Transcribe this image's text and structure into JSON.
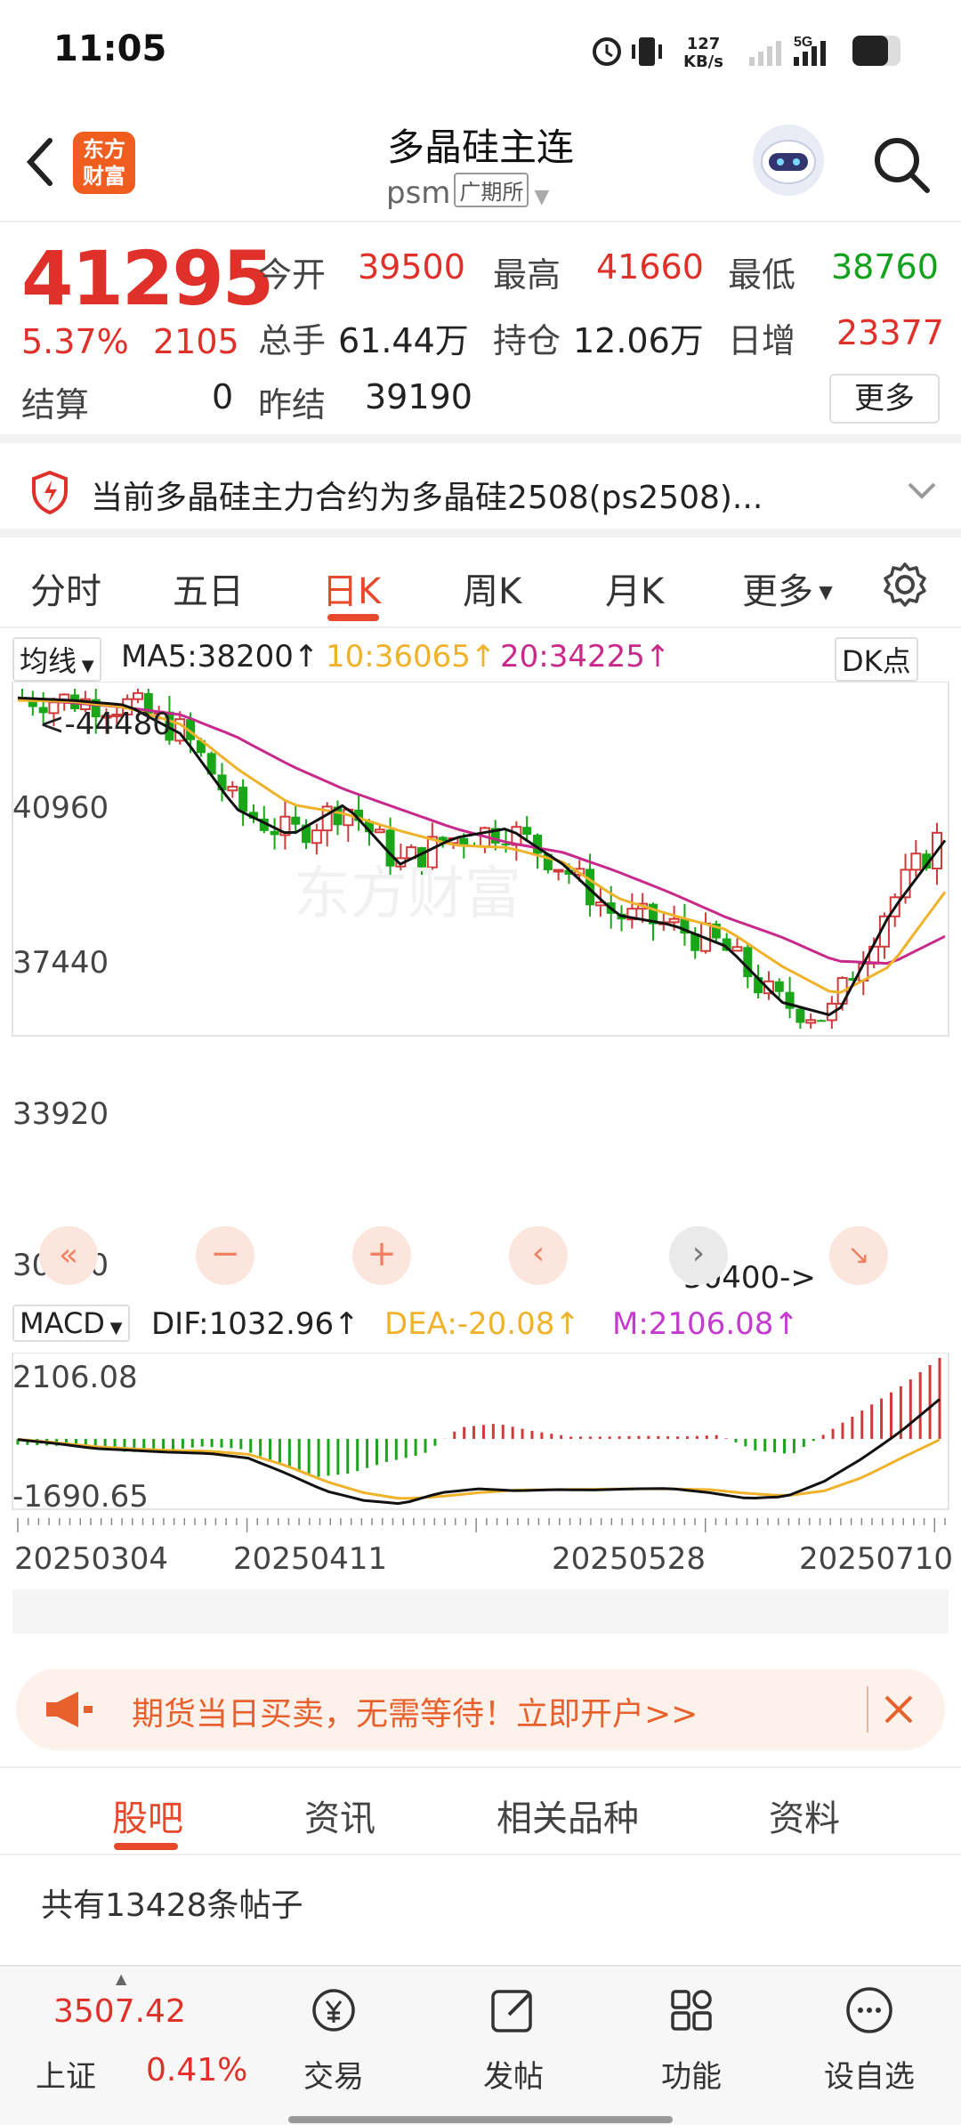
{
  "status": {
    "time": "11:05",
    "net_speed": "127",
    "net_unit": "KB/s",
    "signal_label": "5G"
  },
  "header": {
    "title": "多晶硅主连",
    "code": "psm",
    "exchange": "广期所",
    "logo_line1": "东方",
    "logo_line2": "财富"
  },
  "quote": {
    "price": "41295",
    "change_pct": "5.37%",
    "change": "2105",
    "open_label": "今开",
    "open": "39500",
    "high_label": "最高",
    "high": "41660",
    "low_label": "最低",
    "low": "38760",
    "volume_label": "总手",
    "volume": "61.44万",
    "oi_label": "持仓",
    "oi": "12.06万",
    "daily_add_label": "日增",
    "daily_add": "23377",
    "settle_label": "结算",
    "settle": "0",
    "prev_settle_label": "昨结",
    "prev_settle": "39190",
    "more_label": "更多"
  },
  "notice": {
    "text": "当前多晶硅主力合约为多晶硅2508(ps2508)..."
  },
  "ktabs": [
    "分时",
    "五日",
    "日K",
    "周K",
    "月K",
    "更多"
  ],
  "chart": {
    "ma_select": "均线",
    "ma5": "MA5:38200",
    "ma10": "10:36065",
    "ma20": "20:34225",
    "dk": "DK点",
    "y_labels": [
      "40960",
      "37440",
      "33920",
      "30400"
    ],
    "high_marker": "<-44480",
    "low_marker": "30400->",
    "macd_select": "MACD",
    "dif": "DIF:1032.96",
    "dea": "DEA:-20.08",
    "m": "M:2106.08",
    "macd_max": "2106.08",
    "macd_min": "-1690.65",
    "dates": [
      "20250304",
      "20250411",
      "20250528",
      "20250710"
    ],
    "colors": {
      "up": "#d13a3a",
      "down": "#19a619",
      "ma5": "#111111",
      "ma10": "#f0b22a",
      "ma20": "#c82a8c"
    }
  },
  "chart_data": {
    "type": "candlestick",
    "x": [
      "20250304",
      "20250411",
      "20250528",
      "20250710"
    ],
    "ylim": [
      30400,
      44480
    ],
    "ma5_close": [
      44100,
      44000,
      43800,
      42600,
      39500,
      38400,
      39700,
      37200,
      38300,
      38700,
      37200,
      35100,
      34700,
      33800,
      31500,
      30900,
      35200,
      38200
    ],
    "ma10_close": [
      44000,
      43950,
      43700,
      43000,
      41200,
      39700,
      39300,
      38600,
      38000,
      37900,
      37300,
      35800,
      35100,
      34500,
      33000,
      31800,
      33000,
      36065
    ],
    "ma20_close": [
      44050,
      43900,
      43700,
      43400,
      42500,
      41300,
      40300,
      39500,
      38700,
      38100,
      37700,
      36900,
      36000,
      35000,
      34200,
      33200,
      33100,
      34225
    ],
    "macd": {
      "range": [
        -1690.65,
        2106.08
      ],
      "dif_last": 1032.96,
      "dea_last": -20.08,
      "m_last": 2106.08
    }
  },
  "banner": {
    "text": "期货当日买卖，无需等待！立即开户>>"
  },
  "btabs": [
    "股吧",
    "资讯",
    "相关品种",
    "资料"
  ],
  "posts": "共有13428条帖子",
  "nav": {
    "index_value": "3507.42",
    "index_name": "上证",
    "index_pct": "0.41%",
    "items": [
      "交易",
      "发帖",
      "功能",
      "设自选"
    ]
  }
}
